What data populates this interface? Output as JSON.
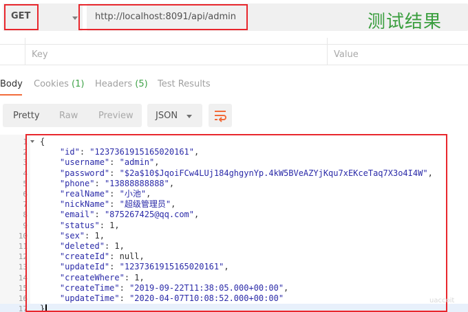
{
  "request": {
    "method": "GET",
    "url": "http://localhost:8091/api/admin",
    "overlay_label": "测试结果"
  },
  "params": {
    "key_placeholder": "Key",
    "value_placeholder": "Value"
  },
  "response_tabs": [
    {
      "label": "Body",
      "count": ""
    },
    {
      "label": "Cookies",
      "count": "(1)"
    },
    {
      "label": "Headers",
      "count": "(5)"
    },
    {
      "label": "Test Results",
      "count": ""
    }
  ],
  "view": {
    "modes": [
      "Pretty",
      "Raw",
      "Preview"
    ],
    "format": "JSON",
    "wrap_icon": "wrap-lines-icon"
  },
  "code_lines": [
    {
      "n": "1",
      "t": "{"
    },
    {
      "n": "2",
      "t": "    \"id\": \"1237361915165020161\","
    },
    {
      "n": "3",
      "t": "    \"username\": \"admin\","
    },
    {
      "n": "4",
      "t": "    \"password\": \"$2a$10$JqoiFCw4LUj184ghgynYp.4kW5BVeAZYjKqu7xEKceTaq7X3o4I4W\","
    },
    {
      "n": "5",
      "t": "    \"phone\": \"13888888888\","
    },
    {
      "n": "6",
      "t": "    \"realName\": \"小池\","
    },
    {
      "n": "7",
      "t": "    \"nickName\": \"超级管理员\","
    },
    {
      "n": "8",
      "t": "    \"email\": \"875267425@qq.com\","
    },
    {
      "n": "9",
      "t": "    \"status\": 1,"
    },
    {
      "n": "10",
      "t": "    \"sex\": 1,"
    },
    {
      "n": "11",
      "t": "    \"deleted\": 1,"
    },
    {
      "n": "12",
      "t": "    \"createId\": null,"
    },
    {
      "n": "13",
      "t": "    \"updateId\": \"1237361915165020161\","
    },
    {
      "n": "14",
      "t": "    \"createWhere\": 1,"
    },
    {
      "n": "15",
      "t": "    \"createTime\": \"2019-09-22T11:38:05.000+00:00\","
    },
    {
      "n": "16",
      "t": "    \"updateTime\": \"2020-04-07T10:08:52.000+00:00\""
    },
    {
      "n": "17",
      "t": "}"
    }
  ],
  "colors": {
    "highlight_box": "#e8262c",
    "accent": "#f26b3a",
    "count_green": "#3ea247",
    "overlay_green": "#3a9e3e"
  },
  "watermark": "uaccoit"
}
